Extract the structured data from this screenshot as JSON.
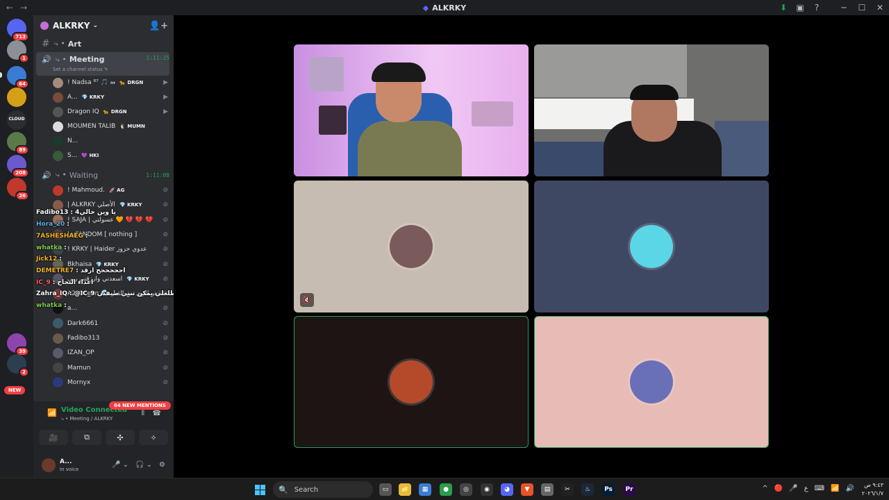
{
  "window": {
    "title": "ALKRKY",
    "nav_back": "←",
    "nav_forward": "→",
    "controls": {
      "minimize": "─",
      "maximize": "☐",
      "close": "✕"
    },
    "tray_icons": {
      "update": "⬇",
      "inbox": "▣",
      "help": "?"
    }
  },
  "rail": {
    "servers": [
      {
        "badge": "713",
        "color": "#5865f2"
      },
      {
        "badge": "1",
        "color": "#8a8f98"
      },
      {
        "badge": "64",
        "color": "#3a7bd5"
      },
      {
        "badge": "",
        "color": "#d4a017"
      },
      {
        "badge": "",
        "color": "#2b2d31",
        "text": "CLOUD"
      },
      {
        "badge": "89",
        "color": "#5a7a4a"
      },
      {
        "badge": "208",
        "color": "#6a5acd"
      },
      {
        "badge": "26",
        "color": "#c0392b"
      },
      {
        "badge": "39",
        "color": "#8e44ad"
      },
      {
        "badge": "2",
        "color": "#2c3e50"
      }
    ],
    "new_label": "NEW"
  },
  "sidebar": {
    "server_name": "ALKRKY",
    "chevron": "⌄",
    "invite_icon": "👤+",
    "channels": {
      "art": {
        "name": "Art",
        "prefix": "⤷ •"
      },
      "meeting": {
        "name": "Meeting",
        "prefix": "⤷ •",
        "timer": "1:11:25",
        "status": "Set a channel status ✎"
      },
      "waiting": {
        "name": "Waiting",
        "prefix": "⤷ •",
        "timer": "1:11:08"
      }
    },
    "meeting_users": [
      {
        "name": "! Nadsa ⁸⁷ 🎵 𝓂",
        "tag": "🐆 DRGN",
        "color": "#a68a7a",
        "icon": "▶"
      },
      {
        "name": "A...",
        "tag": "💎 KRKY",
        "color": "#7a4a3a",
        "icon": "▶"
      },
      {
        "name": "Dragon IQ",
        "tag": "🐆 DRGN",
        "color": "#555",
        "icon": "▶"
      },
      {
        "name": "MOUMEN TALIB",
        "tag": "🐧 MUMN",
        "color": "#ddd",
        "icon": ""
      },
      {
        "name": "N...",
        "tag": "",
        "color": "#1a3a2a",
        "icon": ""
      },
      {
        "name": "S...",
        "tag": "💜 HKI",
        "color": "#3a5a3a",
        "icon": ""
      }
    ],
    "waiting_users": [
      {
        "name": "! Mahmoud.",
        "tag": "🚀 AG",
        "color": "#c0392b"
      },
      {
        "name": "| ALKRKY الأصلي",
        "tag": "💎 KRKY",
        "color": "#8a5a4a"
      },
      {
        "name": "! SAJA | عسولتي 🧡 💔 💔 💔",
        "tag": "",
        "color": "#9a6a5a"
      },
      {
        "name": "| vFANDOM [ nothing ]",
        "tag": "",
        "color": "#5a3a3a"
      },
      {
        "name": "! KRKY | Haider عدوي حزوز",
        "tag": "",
        "color": "#444"
      },
      {
        "name": "Bkhaisa",
        "tag": "💎 KRKY",
        "color": "#665"
      },
      {
        "name": "اسعدني وارزقني ربي",
        "tag": "💎 KRKY",
        "color": "#556"
      },
      {
        "name": "A2_Ocean 🌊 شعر اقوى من القبل",
        "tag": "",
        "color": "#7a3a3a"
      },
      {
        "name": "a...",
        "tag": "",
        "color": "#111"
      },
      {
        "name": "Dark6661",
        "tag": "",
        "color": "#3a5a6a"
      },
      {
        "name": "Fadibo313",
        "tag": "",
        "color": "#6a5a4a"
      },
      {
        "name": "IZAN_OP",
        "tag": "",
        "color": "#5a5a6a"
      },
      {
        "name": "Mamun",
        "tag": "",
        "color": "#444"
      },
      {
        "name": "Mornyx",
        "tag": "",
        "color": "#2a3a7a"
      }
    ],
    "chat_overlay": [
      {
        "user": "Fadibo13",
        "msg": ": 4يا وين خالي",
        "color": "#ffffff"
      },
      {
        "user": "Hora_20",
        "msg": ":",
        "color": "#5dade2"
      },
      {
        "user": "7ASHESHAEG",
        "msg": ":",
        "color": "#f0b429"
      },
      {
        "user": "whatka",
        "msg": ":",
        "color": "#7ec850"
      },
      {
        "user": "Jick12",
        "msg": ":",
        "color": "#f0b429"
      },
      {
        "user": "DEMETRE7",
        "msg": ": احححححح ارقد",
        "color": "#f0b429"
      },
      {
        "user": "IC_9",
        "msg": ": اعداء النجاح",
        "color": "#ff5c5c"
      },
      {
        "user": "Zahra_IQ",
        "msg": ": @IC_9 انا كاعد يطلعلي يمكن تنتي ضيفتي",
        "color": "#ffffff"
      },
      {
        "user": "whatka",
        "msg": ":",
        "color": "#7ec850"
      }
    ],
    "mentions_label": "64 NEW MENTIONS",
    "voice": {
      "status": "Video Connected",
      "location": "⤷ • Meeting / ALKRKY",
      "signal_icon": "📶",
      "soundboard_icon": "⦀",
      "disconnect_icon": "☎",
      "buttons": {
        "camera": "🎥",
        "screen": "⧉",
        "activities": "✣",
        "soundboard": "✧"
      }
    },
    "user_panel": {
      "name": "A...",
      "status": "In voice",
      "mic": "🎤 ⌄",
      "headset": "🎧 ⌄",
      "settings": "⚙"
    }
  },
  "stage": {
    "tiles": [
      {
        "id": "tile-1",
        "kind": "video",
        "bg": "#d8a8e8"
      },
      {
        "id": "tile-2",
        "kind": "video",
        "bg": "#7a7a78"
      },
      {
        "id": "tile-3",
        "kind": "avatar",
        "bg": "#c7bcb1",
        "avatar": "#7a5a5a",
        "muted": true
      },
      {
        "id": "tile-4",
        "kind": "avatar",
        "bg": "#3f4863",
        "avatar": "#5ad6e6",
        "muted": false
      },
      {
        "id": "tile-5",
        "kind": "avatar",
        "bg": "#1f1414",
        "avatar": "#b54a2a",
        "speaking": true
      },
      {
        "id": "tile-6",
        "kind": "avatar",
        "bg": "#e7bcb7",
        "avatar": "#6a70b8",
        "speaking": true
      }
    ],
    "muted_icon": "🔇"
  },
  "taskbar": {
    "search_placeholder": "Search",
    "search_icon": "🔍",
    "apps": [
      {
        "name": "task-view",
        "label": "▭",
        "color": "#555"
      },
      {
        "name": "file-explorer",
        "label": "📁",
        "color": "#e8b93a"
      },
      {
        "name": "store",
        "label": "▦",
        "color": "#3a7bd5"
      },
      {
        "name": "chrome",
        "label": "●",
        "color": "#2a9d4a"
      },
      {
        "name": "obs",
        "label": "◎",
        "color": "#444"
      },
      {
        "name": "steam-alt",
        "label": "◉",
        "color": "#333"
      },
      {
        "name": "discord",
        "label": "◕",
        "color": "#5865f2"
      },
      {
        "name": "brave",
        "label": "▼",
        "color": "#e8532a"
      },
      {
        "name": "notes",
        "label": "▤",
        "color": "#666"
      },
      {
        "name": "capcut",
        "label": "✂",
        "color": "#222"
      },
      {
        "name": "steam",
        "label": "♨",
        "color": "#1b2838"
      },
      {
        "name": "photoshop",
        "label": "Ps",
        "color": "#001e36"
      },
      {
        "name": "premiere",
        "label": "Pr",
        "color": "#2a0a4a"
      }
    ],
    "tray": [
      "^",
      "🔴",
      "🎤",
      "ع",
      "⌨",
      "📶",
      "🔊"
    ],
    "time": "٩:٤٣ ص",
    "date": "٢٠٢٦/١/٧"
  }
}
